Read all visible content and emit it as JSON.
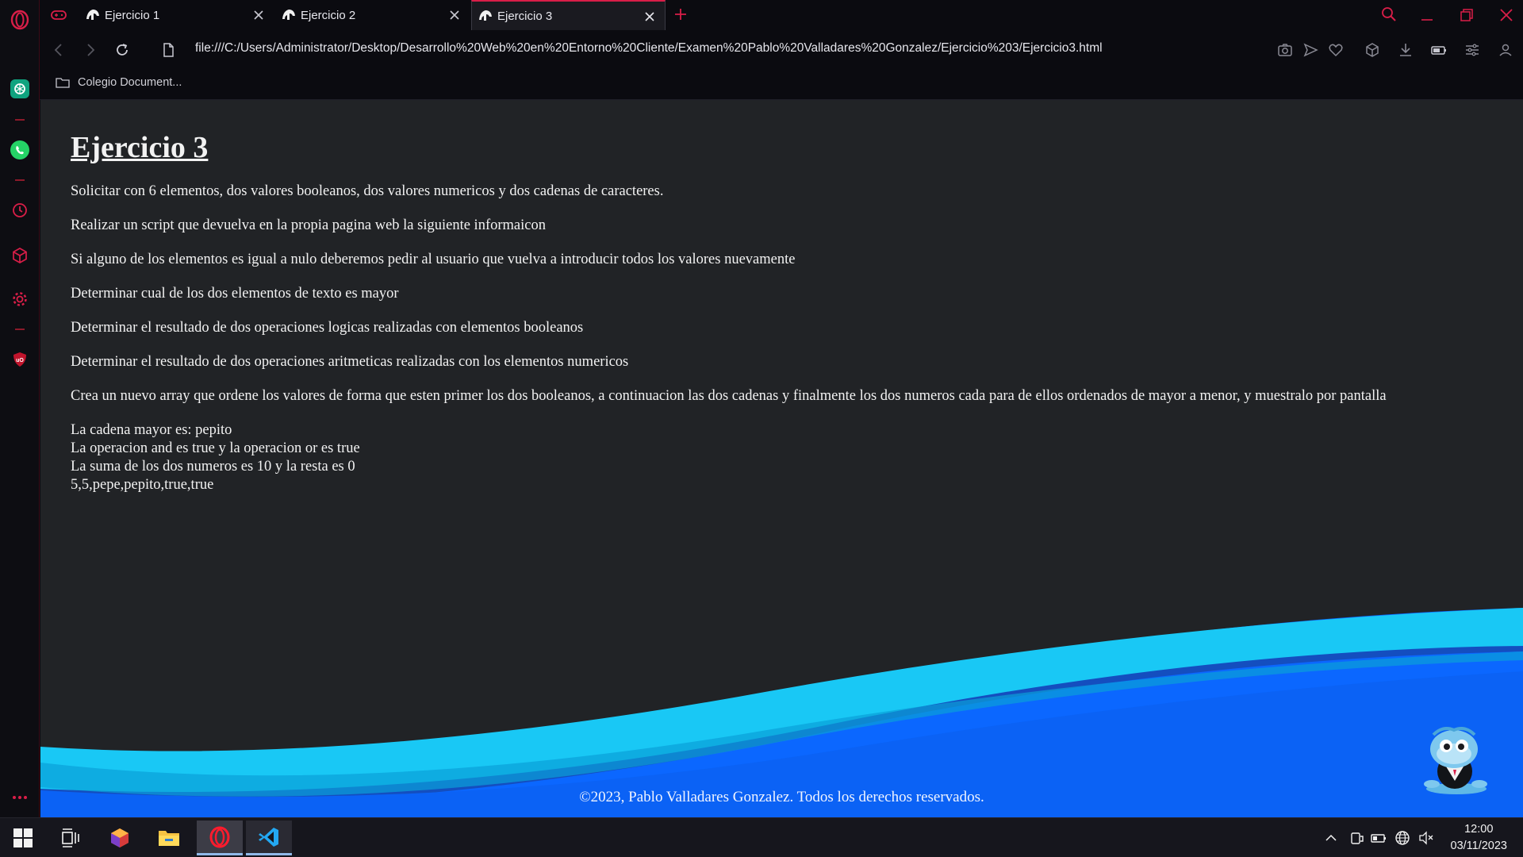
{
  "browser": {
    "tabs": [
      {
        "label": "Ejercicio 1",
        "active": false
      },
      {
        "label": "Ejercicio 2",
        "active": false
      },
      {
        "label": "Ejercicio 3",
        "active": true
      }
    ],
    "url": "file:///C:/Users/Administrator/Desktop/Desarrollo%20Web%20en%20Entorno%20Cliente/Examen%20Pablo%20Valladares%20Gonzalez/Ejercicio%203/Ejercicio3.html",
    "bookmark": "Colegio Document...",
    "accent": "#d91e48"
  },
  "page": {
    "title": "Ejercicio 3",
    "paragraphs": [
      "Solicitar con 6 elementos, dos valores booleanos, dos valores numericos y dos cadenas de caracteres.",
      "Realizar un script que devuelva en la propia pagina web la siguiente informaicon",
      "Si alguno de los elementos es igual a nulo deberemos pedir al usuario que vuelva a introducir todos los valores nuevamente",
      "Determinar cual de los dos elementos de texto es mayor",
      "Determinar el resultado de dos operaciones logicas realizadas con elementos booleanos",
      "Determinar el resultado de dos operaciones aritmeticas realizadas con los elementos numericos",
      "Crea un nuevo array que ordene los valores de forma que esten primer los dos booleanos, a continuacion las dos cadenas y finalmente los dos numeros cada para de ellos ordenados de mayor a menor, y muestralo por pantalla"
    ],
    "output": [
      "La cadena mayor es: pepito",
      "La operacion and es true y la operacion or es true",
      "La suma de los dos numeros es 10 y la resta es 0",
      "5,5,pepe,pepito,true,true"
    ],
    "footer": "©2023, Pablo Valladares Gonzalez. Todos los derechos reservados."
  },
  "taskbar": {
    "time": "12:00",
    "date": "03/11/2023"
  }
}
